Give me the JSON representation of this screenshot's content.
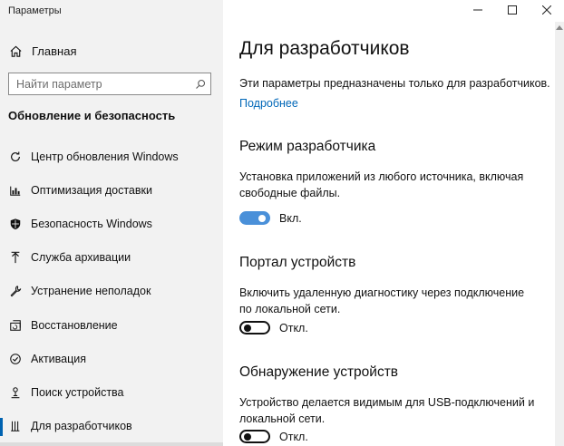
{
  "window": {
    "title": "Параметры"
  },
  "sidebar": {
    "home_label": "Главная",
    "search_placeholder": "Найти параметр",
    "section_title": "Обновление и безопасность",
    "items": [
      {
        "label": "Центр обновления Windows",
        "icon": "refresh-icon"
      },
      {
        "label": "Оптимизация доставки",
        "icon": "delivery-optimization-icon"
      },
      {
        "label": "Безопасность Windows",
        "icon": "shield-icon"
      },
      {
        "label": "Служба архивации",
        "icon": "backup-arrow-icon"
      },
      {
        "label": "Устранение неполадок",
        "icon": "wrench-icon"
      },
      {
        "label": "Восстановление",
        "icon": "recovery-icon"
      },
      {
        "label": "Активация",
        "icon": "check-circle-icon"
      },
      {
        "label": "Поиск устройства",
        "icon": "person-pin-icon"
      },
      {
        "label": "Для разработчиков",
        "icon": "developer-tools-icon",
        "active": true
      }
    ]
  },
  "main": {
    "title": "Для разработчиков",
    "intro": "Эти параметры предназначены только для разработчиков.",
    "more_link": "Подробнее",
    "sections": [
      {
        "heading": "Режим разработчика",
        "description": "Установка приложений из любого источника, включая свободные файлы.",
        "toggle_on": true,
        "toggle_label": "Вкл."
      },
      {
        "heading": "Портал устройств",
        "description": "Включить удаленную диагностику через подключение по локальной сети.",
        "toggle_on": false,
        "toggle_label": "Откл."
      },
      {
        "heading": "Обнаружение устройств",
        "description": "Устройство делается видимым для USB-подключений и локальной сети.",
        "toggle_on": false,
        "toggle_label": "Откл."
      }
    ]
  },
  "colors": {
    "sidebar_bg": "#f2f2f2",
    "accent": "#0063b1",
    "link": "#0067b8",
    "toggle_on": "#4a90d9"
  }
}
